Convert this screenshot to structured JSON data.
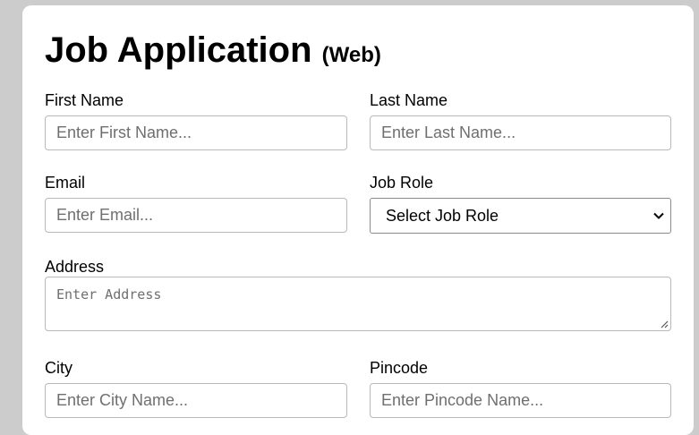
{
  "form": {
    "title": "Job Application",
    "subtitle": "(Web)",
    "first_name": {
      "label": "First Name",
      "placeholder": "Enter First Name..."
    },
    "last_name": {
      "label": "Last Name",
      "placeholder": "Enter Last Name..."
    },
    "email": {
      "label": "Email",
      "placeholder": "Enter Email..."
    },
    "job_role": {
      "label": "Job Role",
      "selected": "Select Job Role",
      "icon": "chevron-down-icon"
    },
    "address": {
      "label": "Address",
      "placeholder": "Enter Address",
      "icon": "resize-grip-icon"
    },
    "city": {
      "label": "City",
      "placeholder": "Enter City Name..."
    },
    "pincode": {
      "label": "Pincode",
      "placeholder": "Enter Pincode Name..."
    }
  },
  "colors": {
    "page_background": "#cccccc",
    "card_background": "#ffffff",
    "input_border": "#b9b9b9",
    "placeholder_text": "#6f6f6f"
  }
}
